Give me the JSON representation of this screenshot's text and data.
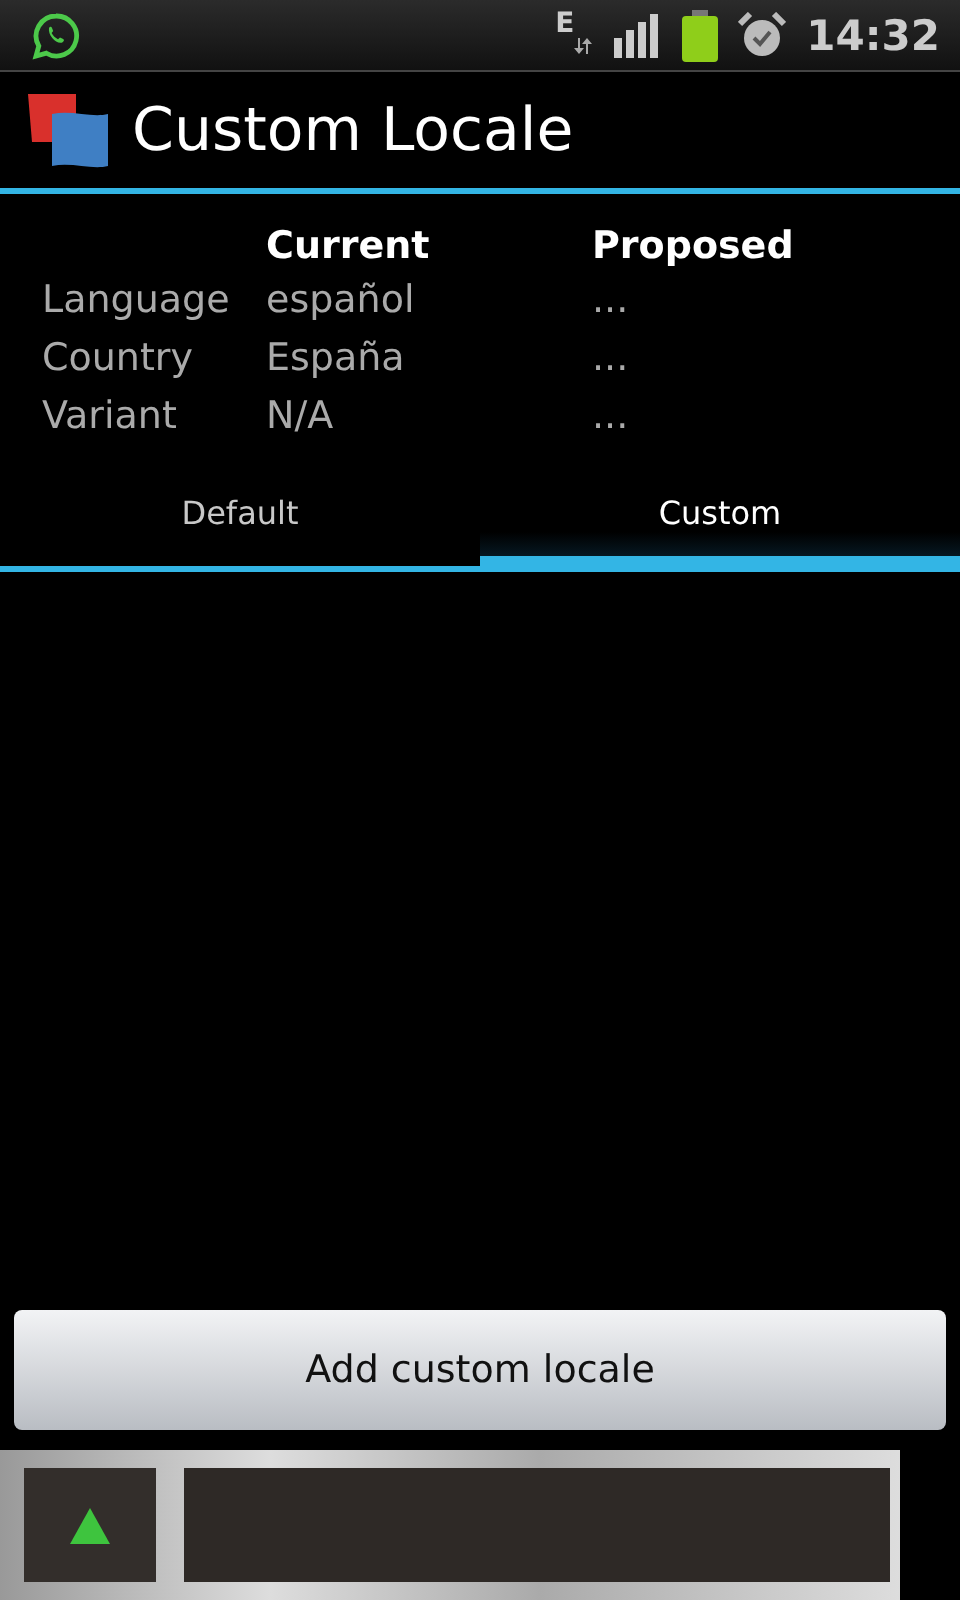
{
  "status_bar": {
    "network": "E",
    "time": "14:32"
  },
  "title": "Custom Locale",
  "table": {
    "columns": [
      "Current",
      "Proposed"
    ],
    "rows": [
      {
        "label": "Language",
        "current": "español",
        "proposed": "..."
      },
      {
        "label": "Country",
        "current": "España",
        "proposed": "..."
      },
      {
        "label": "Variant",
        "current": "N/A",
        "proposed": "..."
      }
    ]
  },
  "tabs": [
    {
      "label": "Default",
      "selected": false
    },
    {
      "label": "Custom",
      "selected": true
    }
  ],
  "button": "Add custom locale"
}
